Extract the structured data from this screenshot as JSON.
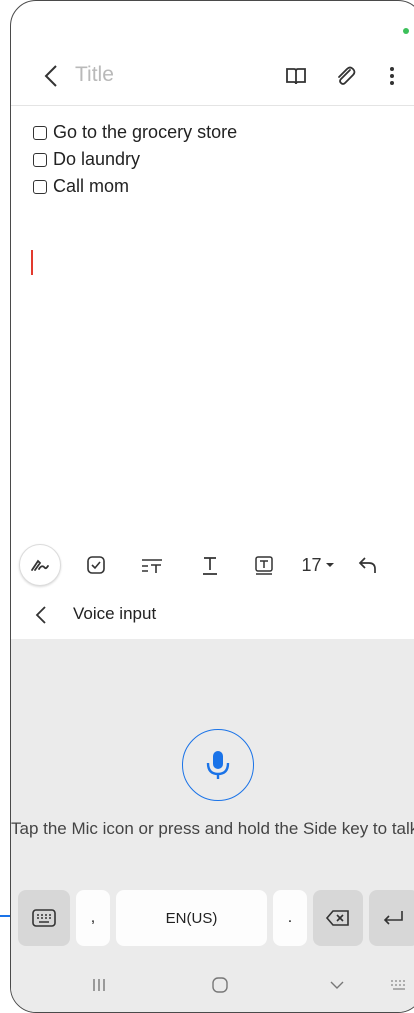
{
  "header": {
    "title_placeholder": "Title",
    "back_icon": "chevron-left-icon",
    "icons": [
      "book-icon",
      "attach-icon",
      "more-vert-icon"
    ]
  },
  "note": {
    "items": [
      {
        "label": "Go to the grocery store",
        "checked": false
      },
      {
        "label": "Do laundry",
        "checked": false
      },
      {
        "label": "Call mom",
        "checked": false
      }
    ]
  },
  "toolbar": {
    "font_size": "17",
    "tools": [
      "pen-icon",
      "checkbox-icon",
      "text-style-icon",
      "underline-text-icon",
      "text-box-icon",
      "undo-icon"
    ]
  },
  "voice": {
    "title": "Voice input",
    "hint": "Tap the Mic icon or press and hold the Side key to talk."
  },
  "keyboard": {
    "comma": ",",
    "language": "EN(US)",
    "period": "."
  },
  "colors": {
    "accent": "#1a73e8",
    "cursor": "#e23a2e",
    "camera": "#3cc05a"
  }
}
